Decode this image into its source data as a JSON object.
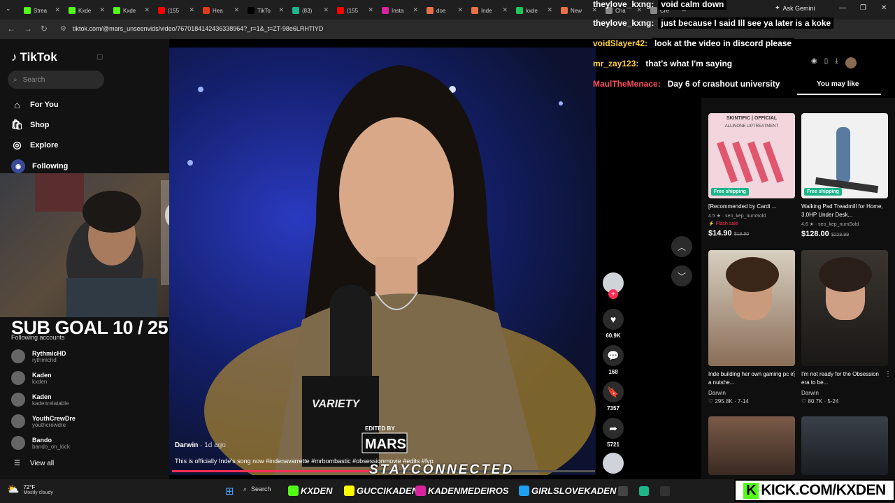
{
  "browser": {
    "tabs": [
      {
        "label": "Strea",
        "color": "#53fc18"
      },
      {
        "label": "Kxde",
        "color": "#53fc18"
      },
      {
        "label": "Kxde",
        "color": "#53fc18"
      },
      {
        "label": "(155",
        "color": "#ff0000"
      },
      {
        "label": "Hea",
        "color": "#e03a1c"
      },
      {
        "label": "TikTo",
        "color": "#000000"
      },
      {
        "label": "(83)",
        "color": "#1db58a"
      },
      {
        "label": "(155",
        "color": "#ff0000"
      },
      {
        "label": "Insta",
        "color": "#d6249f"
      },
      {
        "label": "doe",
        "color": "#e8704a"
      },
      {
        "label": "Inde",
        "color": "#e8704a"
      },
      {
        "label": "kxde",
        "color": "#1ec65c"
      },
      {
        "label": "New",
        "color": "#e8704a"
      },
      {
        "label": "Cha",
        "color": "#888888"
      },
      {
        "label": "Cre",
        "color": "#888888"
      }
    ],
    "url": "tiktok.com/@mars_unseenvids/video/7670184142436338964?_r=1&_t=ZT-98e6LRHTIYD",
    "ask_gemini": "Ask Gemini"
  },
  "chat": [
    {
      "user": "theylove_kxng:",
      "msg": "void calm down",
      "color": "#ffffff"
    },
    {
      "user": "theylove_kxng:",
      "msg": "just because I said Ill see ya later is a koke",
      "color": "#ffffff"
    },
    {
      "user": "voidSlayer42:",
      "msg": "look at the video in discord please",
      "color": "#ffd23f"
    },
    {
      "user": "mr_zay123:",
      "msg": "that's what I'm saying",
      "color": "#ffd23f"
    },
    {
      "user": "MaulTheMenace:",
      "msg": "Day 6 of crashout university",
      "color": "#ff4d5e"
    }
  ],
  "tiktok": {
    "logo": "TikTok",
    "search_placeholder": "Search",
    "nav": [
      {
        "label": "For You",
        "icon": "home-icon"
      },
      {
        "label": "Shop",
        "icon": "shop-icon"
      },
      {
        "label": "Explore",
        "icon": "compass-icon"
      },
      {
        "label": "Following",
        "icon": "following-icon"
      }
    ],
    "following_heading": "Following accounts",
    "accounts": [
      {
        "name": "RythmicHD",
        "handle": "rythmichd"
      },
      {
        "name": "Kaden",
        "handle": "kxden"
      },
      {
        "name": "Kaden",
        "handle": "kadenrelatable"
      },
      {
        "name": "YouthCrewDre",
        "handle": "youthcrewdre"
      },
      {
        "name": "Bando",
        "handle": "bando_on_kick"
      }
    ],
    "view_all": "View all",
    "video": {
      "author": "Darwin",
      "time": " · 1d ago",
      "caption": "This is officially Inde's song now #indenavarrette #mrbombastic #obsessionmovie #edits #fyp",
      "watermark": "EDITED BY",
      "watermark_name": "MARS",
      "mic_brand": "VARIETY",
      "progress": 0.47
    },
    "actions": {
      "likes": "60.9K",
      "comments": "168",
      "saves": "7357",
      "shares": "5721"
    },
    "you_may_like": "You may like",
    "products": [
      {
        "title": "[Recommended by Cardi ...",
        "badge": "Free shipping",
        "rating": "4.5 ★ · seo_kep_numSold",
        "flash": "Flash sale",
        "price": "$14.90",
        "old": "$19.90",
        "img_label": "SKINTIFIC | OFFICIAL",
        "img_sub": "ALLINONE LIPTREATMENT"
      },
      {
        "title": "Walking Pad Treadmill for Home, 3.0HP Under Desk...",
        "badge": "Free shipping",
        "rating": "4.6 ★ · seo_kep_numSold",
        "flash": "",
        "price": "$128.00",
        "old": "$229.99"
      }
    ],
    "videos": [
      {
        "title": "Inde building her own gaming pc in a nutshe...",
        "author": "Darwin",
        "stats": "♡ 295.8K · 7-14"
      },
      {
        "title": "I'm not ready for the Obsession era to be...",
        "author": "Darwin",
        "stats": "♡ 80.7K · 5-24"
      }
    ]
  },
  "overlay": {
    "sub_goal": "SUB GOAL 10 / 25",
    "stay_connected": "STAYCONNECTED",
    "socials": [
      {
        "label": "KXDEN",
        "color": "#53fc18"
      },
      {
        "label": "GUCCIKADEN",
        "color": "#fffc00"
      },
      {
        "label": "KADENMEDEIROS",
        "color": "#d6249f"
      },
      {
        "label": "GIRLSLOVEKADEN",
        "color": "#1da1f2"
      }
    ],
    "kick_url": "KICK.COM/KXDEN"
  },
  "taskbar": {
    "temp": "72°F",
    "condition": "Mostly cloudy",
    "search": "Search"
  }
}
